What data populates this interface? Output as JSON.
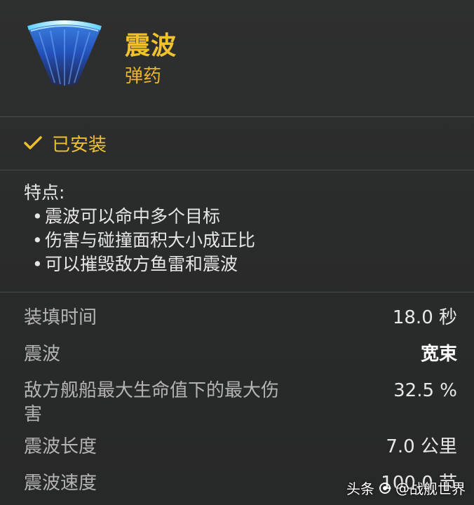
{
  "header": {
    "icon": "shockwave-ammo-icon",
    "title": "震波",
    "subtitle": "弹药"
  },
  "status": {
    "icon": "check-icon",
    "label": "已安装"
  },
  "features": {
    "title": "特点:",
    "bullet": "•",
    "items": [
      "震波可以命中多个目标",
      "伤害与碰撞面积大小成正比",
      "可以摧毁敌方鱼雷和震波"
    ]
  },
  "stats": [
    {
      "label": "装填时间",
      "value": "18.0 秒"
    },
    {
      "label": "震波",
      "value": "宽束"
    },
    {
      "label": "敌方舰船最大生命值下的最大伤害",
      "value": "32.5 %"
    },
    {
      "label": "震波长度",
      "value": "7.0 公里"
    },
    {
      "label": "震波速度",
      "value": "100.0 节"
    }
  ],
  "watermark": {
    "prefix": "头条",
    "at": "@",
    "name": "战舰世界"
  },
  "colors": {
    "accent": "#f2c12e",
    "background": "#2b2c2c",
    "label": "#b4b4b4",
    "value": "#e8e8e8"
  }
}
